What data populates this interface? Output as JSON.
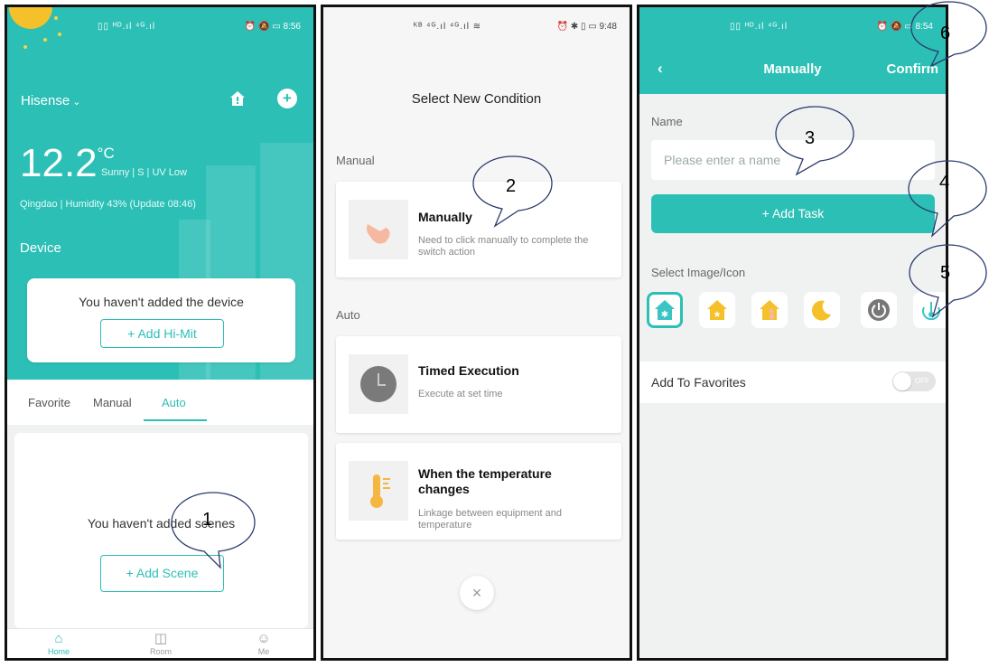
{
  "screen1": {
    "status_time": "8:56",
    "status_left": "▯▯ ᴴᴰ.ıl ⁴ᴳ.ıl",
    "status_right": "⏰ 🔕 ▭",
    "brand": "Hisense",
    "temperature": "12.2",
    "temp_unit": "°C",
    "weather": "Sunny  |  S  |  UV Low",
    "location_line": "Qingdao  |  Humidity 43%  (Update 08:46)",
    "device_label": "Device",
    "no_device_msg": "You haven't added the device",
    "add_hi_mit": "+   Add Hi-Mit",
    "tabs": [
      "Favorite",
      "Manual",
      "Auto"
    ],
    "no_scene_msg": "You haven't added scenes",
    "add_scene": "+   Add Scene",
    "nav": [
      "Home",
      "Room",
      "Me"
    ]
  },
  "screen2": {
    "status_time": "9:48",
    "status_left": "ᴷᴮ ⁴ᴳ.ıl ⁴ᴳ.ıl ≋",
    "status_right": "⏰ ✱ ▯ ▭",
    "title": "Select New Condition",
    "section_manual": "Manual",
    "section_auto": "Auto",
    "cards": [
      {
        "title": "Manually",
        "desc": "Need to click manually to complete the switch action"
      },
      {
        "title": "Timed Execution",
        "desc": "Execute at set time"
      },
      {
        "title": "When the temperature changes",
        "desc": "Linkage between equipment and temperature"
      }
    ],
    "close_symbol": "×"
  },
  "screen3": {
    "status_time": "8:54",
    "status_left": "▯▯ ᴴᴰ.ıl ⁴ᴳ.ıl",
    "status_right": "⏰ 🔕 ▭",
    "back": "‹",
    "title": "Manually",
    "confirm": "Confirm",
    "name_label": "Name",
    "name_placeholder": "Please enter a name",
    "add_task": "+ Add Task",
    "image_label": "Select Image/Icon",
    "icons": [
      "snowflake-house-icon",
      "star-house-icon",
      "person-house-icon",
      "moon-icon",
      "power-icon",
      "thermometer-icon"
    ],
    "favorites_label": "Add To Favorites",
    "toggle_text": "OFF"
  },
  "annotations": [
    "1",
    "2",
    "3",
    "4",
    "5",
    "6"
  ],
  "colors": {
    "accent": "#2cbfb5",
    "sun": "#f5c12a"
  }
}
